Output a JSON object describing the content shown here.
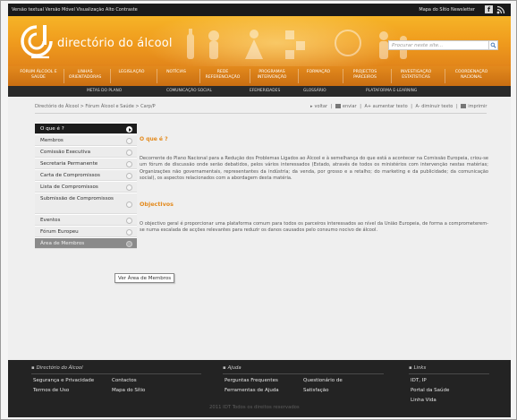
{
  "topbar": {
    "left_text": "Versão textual  Versão Móvel  Visualização Alto Contraste",
    "right_text": "Mapa do Sítio  Newsletter"
  },
  "header": {
    "logo_text": "directório do álcool",
    "search_placeholder": "Procurar neste site..."
  },
  "nav": {
    "items": [
      "Fórum Álcool e Saúde",
      "Linhas Orientadoras",
      "Legislação",
      "Notícias",
      "Rede Referenciação",
      "Programas Intervenção",
      "Formação",
      "Projectos Parceiros",
      "Investigação Estatísticas",
      "Coordenação Nacional"
    ]
  },
  "subnav": {
    "items": [
      "Metas do Plano",
      "Comunicação Social",
      "Efemeridades",
      "Glossário",
      "Plataforma e-Learning"
    ]
  },
  "breadcrumb": "Directório do Álcool  >  Fórum Álcool e Saúde  >  Carp/P",
  "tools": {
    "back": "voltar",
    "send": "enviar",
    "increase": "A+ aumentar texto",
    "decrease": "A- diminuir texto",
    "print": "imprimir"
  },
  "sidebar": {
    "items": [
      {
        "label": "O que é ?"
      },
      {
        "label": "Membros"
      },
      {
        "label": "Comissão Executiva"
      },
      {
        "label": "Secretaria Permanente"
      },
      {
        "label": "Carta de Compromissos"
      },
      {
        "label": "Lista de Compromissos"
      },
      {
        "label": "Submissão de Compromissos"
      },
      {
        "label": "Eventos"
      },
      {
        "label": "Fórum Europeu"
      },
      {
        "label": "Área de Membros"
      }
    ],
    "tooltip": "Ver Área de Membros"
  },
  "content": {
    "heading1": "O que é ?",
    "para1": "Decorrente do Plano Nacional para a Redução dos Problemas Ligados ao Álcool e à semelhança do que está a acontecer na Comissão Europeia, criou-se um fórum de discussão onde serão debatidos, pelos vários interessados (Estado, através de todos os ministérios com intervenção nestas matérias; Organizações não governamentais, representantes da indústria; da venda, por grosso e a retalho; do marketing e da publicidade; da comunicação social), os aspectos relacionados com a abordagem desta matéria.",
    "heading2": "Objectivos",
    "para2": "O objectivo geral é proporcionar uma plataforma comum para todos os parceiros interessados ao nível da União Europeia, de forma a comprometerem-se numa escalada de acções relevantes para reduzir os danos causados pelo consumo nocivo de álcool."
  },
  "footer": {
    "col1_title": "Directório do Álcool",
    "col1_links": [
      "Segurança e Privacidade",
      "Contactos",
      "Termos de Uso",
      "Mapa do Sítio"
    ],
    "col2_title": "Ajuda",
    "col2_links": [
      "Perguntas Frequentes",
      "Questionário de",
      "Ferramentas de Ajuda",
      "Satisfação"
    ],
    "col3_title": "Links",
    "col3_links": [
      "IDT, IP",
      "Portal da Saúde",
      "Linha Vida"
    ],
    "copyright": "2011 IDT Todos os direitos reservados"
  },
  "colors": {
    "brand_orange": "#ef9a1d",
    "nav_orange": "#c96e12",
    "sidebar_active": "#1c1c1c",
    "footer_bg": "#232323"
  }
}
